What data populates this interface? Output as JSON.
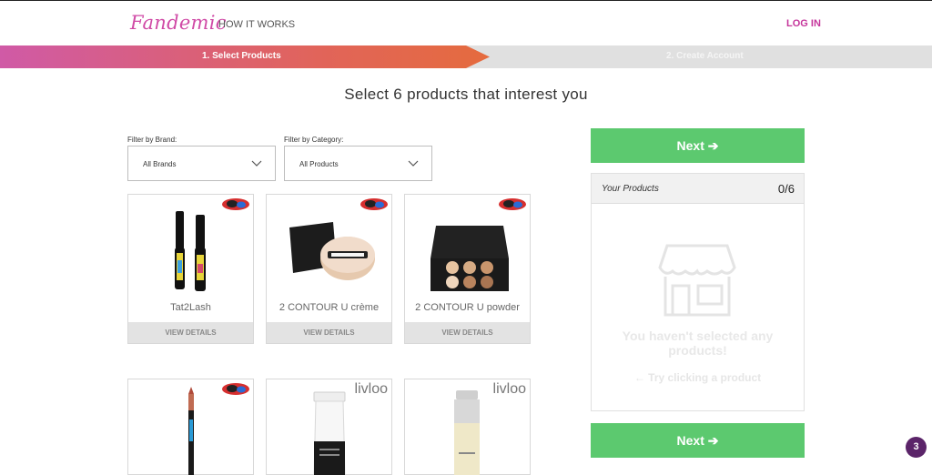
{
  "header": {
    "logo": "Fandemic",
    "nav_how": "HOW IT WORKS",
    "login": "LOG IN"
  },
  "steps": {
    "step1": "1. Select Products",
    "step2": "2. Create Account"
  },
  "heading": "Select 6 products that interest you",
  "filters": {
    "brand_label": "Filter by Brand:",
    "brand_value": "All Brands",
    "category_label": "Filter by Category:",
    "category_value": "All Products"
  },
  "products": [
    {
      "name": "Tat2Lash",
      "details": "VIEW DETAILS"
    },
    {
      "name": "2 CONTOUR U crème",
      "details": "VIEW DETAILS"
    },
    {
      "name": "2 CONTOUR U powder",
      "details": "VIEW DETAILS"
    },
    {
      "name": "",
      "details": ""
    },
    {
      "name": "",
      "details": "",
      "brand": "livloo"
    },
    {
      "name": "",
      "details": "",
      "brand": "livloo"
    }
  ],
  "sidebar": {
    "next_label": "Next ➔",
    "panel_title": "Your Products",
    "count": "0/6",
    "empty_line1": "You haven't selected any",
    "empty_line2": "products!",
    "try": "← Try clicking a product"
  },
  "notification_count": "3",
  "colors": {
    "brand_pink": "#d04aa6",
    "next_green": "#5cc96f",
    "notif_purple": "#5b2469"
  }
}
